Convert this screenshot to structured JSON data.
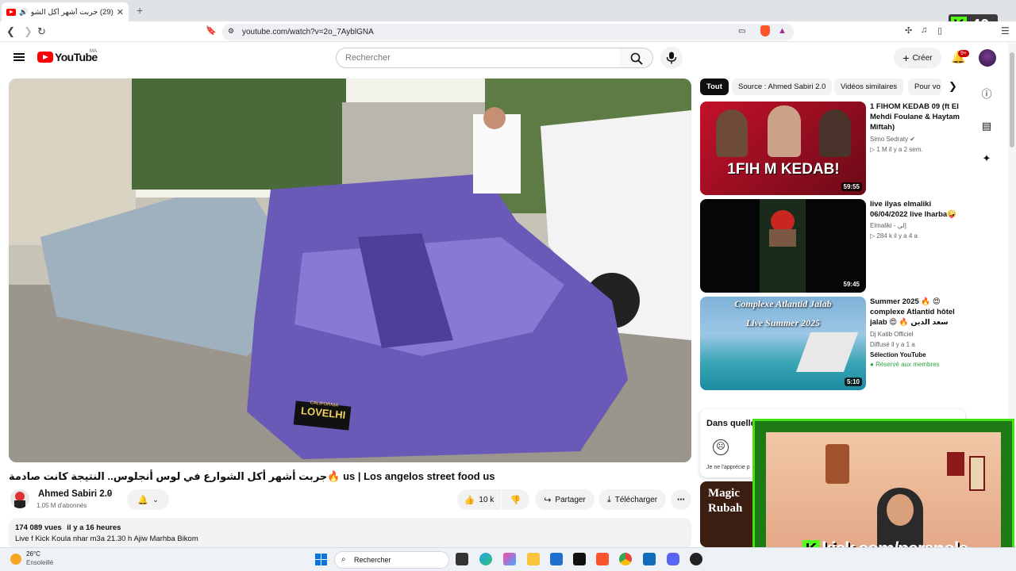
{
  "browser": {
    "tab_title": "(29) جربت أشهر أكل الشوارع م...",
    "tab_close": "✕",
    "new_tab": "+",
    "url": "youtube.com/watch?v=2o_7AyblGNA",
    "kick_overlay_number": "40"
  },
  "yt_header": {
    "logo_text": "YouTube",
    "country_code": "MA",
    "search_placeholder": "Rechercher",
    "create_label": "Créer",
    "notif_badge": "9+"
  },
  "chips": [
    "Tout",
    "Source : Ahmed Sabiri 2.0",
    "Vidéos similaires",
    "Pour vo"
  ],
  "video": {
    "plate_top": "CALIFORNIA",
    "plate": "LOVELHI",
    "title": "جربت أشهر أكل الشوارع في لوس أنجلوس.. النتيجة كانت صادمة🔥 us | Los angelos street food us",
    "channel_name": "Ahmed Sabiri 2.0",
    "subscribers": "1,05 M d'abonnés",
    "likes": "10 k",
    "share_label": "Partager",
    "download_label": "Télécharger",
    "views": "174 089 vues",
    "age": "il y a 16 heures",
    "description": "Live f Kick Koula nhar m3a 21.30 h Ajiw Marhba Bikom"
  },
  "recommendations": [
    {
      "title": "1 FIHOM KEDAB 09 (ft El Mehdi Foulane & Haytam Miftah)",
      "channel": "Simo Sedraty",
      "meta": "▷ 1 M   il y a 2 sem.",
      "duration": "59:55",
      "thumb_text": "1FIH  M KEDAB!"
    },
    {
      "title": "live ilyas elmaliki 06/04/2022 live lharba🤪",
      "channel": "Elmaliki - إلي",
      "meta": "▷ 284 k   il y a 4 a",
      "duration": "59:45"
    },
    {
      "title": "Summer 2025 🔥 😍 complexe Atlantid hôtel jalab 😍 🔥 سعد الدين للسياحة ...",
      "channel": "Dj Katib Officiel",
      "meta": "Diffusé il y a 1 a",
      "extra": "Sélection YouTube",
      "badge": "Réservé aux membres",
      "duration": "5:10",
      "thumb_line1": "Complexe Atlantid Jalab",
      "thumb_line2": "Live Summer 2025"
    },
    {
      "thumb_text": "Magic Rubah"
    }
  ],
  "survey": {
    "question": "Dans quelle m",
    "option": "Je ne l'apprécie p"
  },
  "webcam": {
    "kick_label": "kick.com/paranole"
  },
  "taskbar": {
    "temperature": "26°C",
    "weather": "Ensoleillé",
    "search": "Rechercher"
  },
  "colors": {
    "yt_red": "#ff0000",
    "kick_green": "#53fc18",
    "chip_active": "#0f0f0f"
  }
}
